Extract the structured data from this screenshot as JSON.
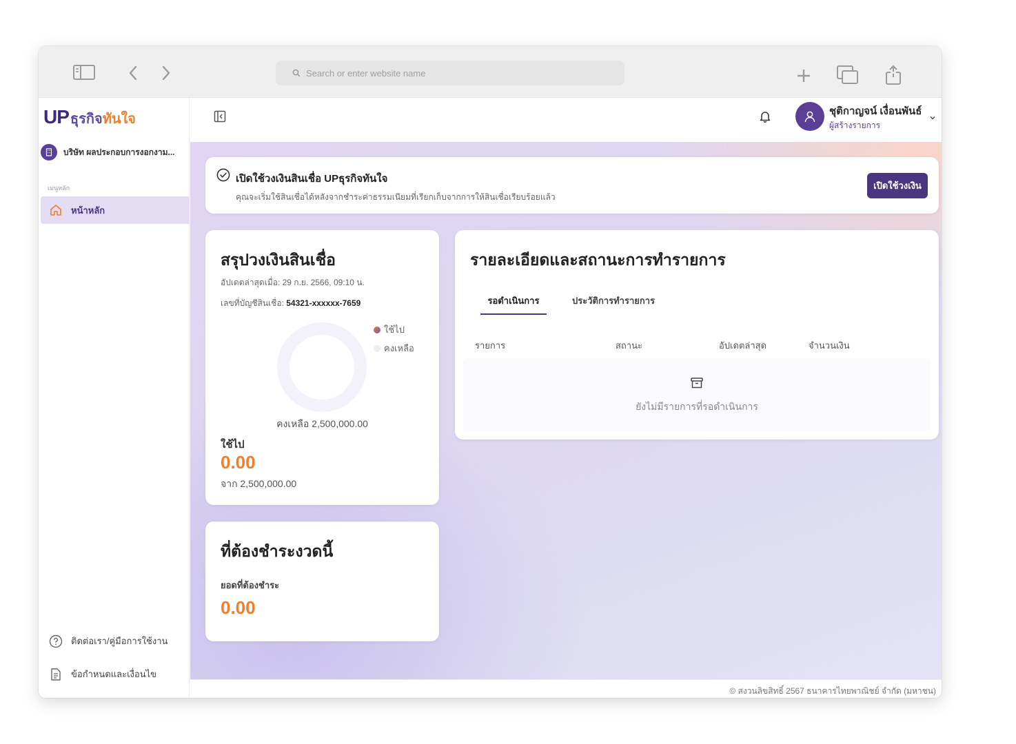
{
  "browser": {
    "address_placeholder": "Search or enter website name"
  },
  "sidebar": {
    "logo_up": "UP",
    "logo_th_1": "ธุรกิจ",
    "logo_th_2": "ทันใจ",
    "company": "บริษัท ผลประกอบการงอกงาม...",
    "menu_label": "เมนูหลัก",
    "home": "หน้าหลัก",
    "contact": "ติดต่อเรา/คู่มือการใช้งาน",
    "terms": "ข้อกำหนดและเงื่อนไข"
  },
  "user": {
    "name": "ชุติกาญจน์ เงื่อนพันธ์",
    "role": "ผู้สร้างรายการ"
  },
  "banner": {
    "title": "เปิดใช้วงเงินสินเชื่อ UPธุรกิจทันใจ",
    "subtitle": "คุณจะเริ่มใช้สินเชื่อได้หลังจากชำระค่าธรรมเนียมที่เรียกเก็บจากการให้สินเชื่อเรียบร้อยแล้ว",
    "button": "เปิดใช้วงเงิน"
  },
  "summary": {
    "title": "สรุปวงเงินสินเชื่อ",
    "updated": "อัปเดตล่าสุดเมื่อ: 29 ก.ย. 2566, 09:10 น.",
    "account_label": "เลขที่บัญชีสินเชื่อ:",
    "account_number": "54321-xxxxxx-7659",
    "legend_used": "ใช้ไป",
    "legend_remaining": "คงเหลือ",
    "remaining_text": "คงเหลือ 2,500,000.00",
    "used_label": "ใช้ไป",
    "used_value": "0.00",
    "from_text": "จาก 2,500,000.00",
    "used_color": "#8a6fd1",
    "remaining_color": "#f3f2fa",
    "used_amount": 0,
    "total_amount": 2500000
  },
  "due": {
    "title": "ที่ต้องชำระงวดนี้",
    "label": "ยอดที่ต้องชำระ",
    "value": "0.00"
  },
  "details": {
    "title": "รายละเอียดและสถานะการทำรายการ",
    "tabs": [
      "รอดำเนินการ",
      "ประวัติการทำรายการ"
    ],
    "columns": [
      "รายการ",
      "สถานะ",
      "อัปเดตล่าสุด",
      "จำนวนเงิน"
    ],
    "empty_message": "ยังไม่มีรายการที่รอดำเนินการ"
  },
  "footer": {
    "copyright": "© สงวนลิขสิทธิ์ 2567 ธนาคารไทยพาณิชย์ จำกัด (มหาชน)"
  },
  "colors": {
    "brand_purple": "#4a3580",
    "accent_orange": "#ef7f2e"
  }
}
